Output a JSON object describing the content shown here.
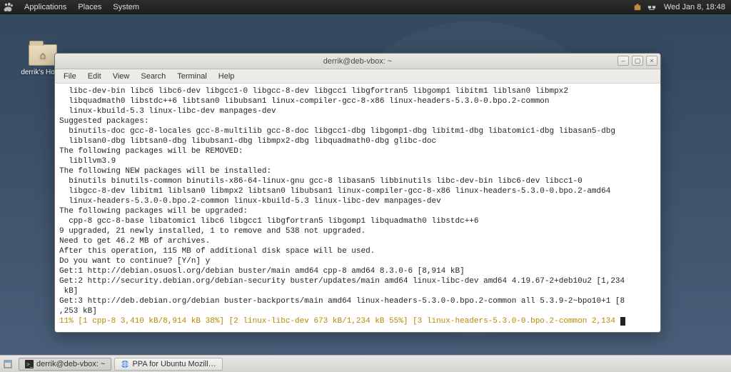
{
  "panel": {
    "menus": [
      "Applications",
      "Places",
      "System"
    ],
    "clock": "Wed Jan  8, 18:48"
  },
  "desktop": {
    "home_label": "derrik's Home"
  },
  "window": {
    "title": "derrik@deb-vbox: ~",
    "menubar": [
      "File",
      "Edit",
      "View",
      "Search",
      "Terminal",
      "Help"
    ],
    "btn_min": "–",
    "btn_max": "▢",
    "btn_close": "×"
  },
  "terminal": {
    "lines": [
      "  libc-dev-bin libc6 libc6-dev libgcc1-0 libgcc-8-dev libgcc1 libgfortran5 libgomp1 libitm1 liblsan0 libmpx2",
      "  libquadmath0 libstdc++6 libtsan0 libubsan1 linux-compiler-gcc-8-x86 linux-headers-5.3.0-0.bpo.2-common",
      "  linux-kbuild-5.3 linux-libc-dev manpages-dev",
      "Suggested packages:",
      "  binutils-doc gcc-8-locales gcc-8-multilib gcc-8-doc libgcc1-dbg libgomp1-dbg libitm1-dbg libatomic1-dbg libasan5-dbg",
      "  liblsan0-dbg libtsan0-dbg libubsan1-dbg libmpx2-dbg libquadmath0-dbg glibc-doc",
      "The following packages will be REMOVED:",
      "  libllvm3.9",
      "The following NEW packages will be installed:",
      "  binutils binutils-common binutils-x86-64-linux-gnu gcc-8 libasan5 libbinutils libc-dev-bin libc6-dev libcc1-0",
      "  libgcc-8-dev libitm1 liblsan0 libmpx2 libtsan0 libubsan1 linux-compiler-gcc-8-x86 linux-headers-5.3.0-0.bpo.2-amd64",
      "  linux-headers-5.3.0-0.bpo.2-common linux-kbuild-5.3 linux-libc-dev manpages-dev",
      "The following packages will be upgraded:",
      "  cpp-8 gcc-8-base libatomic1 libc6 libgcc1 libgfortran5 libgomp1 libquadmath0 libstdc++6",
      "9 upgraded, 21 newly installed, 1 to remove and 538 not upgraded.",
      "Need to get 46.2 MB of archives.",
      "After this operation, 115 MB of additional disk space will be used.",
      "Do you want to continue? [Y/n] y",
      "Get:1 http://debian.osuosl.org/debian buster/main amd64 cpp-8 amd64 8.3.0-6 [8,914 kB]",
      "Get:2 http://security.debian.org/debian-security buster/updates/main amd64 linux-libc-dev amd64 4.19.67-2+deb10u2 [1,234",
      " kB]",
      "Get:3 http://deb.debian.org/debian buster-backports/main amd64 linux-headers-5.3.0-0.bpo.2-common all 5.3.9-2~bpo10+1 [8",
      ",253 kB]"
    ],
    "progress": "11% [1 cpp-8 3,410 kB/8,914 kB 38%] [2 linux-libc-dev 673 kB/1,234 kB 55%] [3 linux-headers-5.3.0-0.bpo.2-common 2,134 "
  },
  "taskbar": {
    "items": [
      {
        "label": "derrik@deb-vbox: ~",
        "active": true,
        "icon": "terminal"
      },
      {
        "label": "PPA for Ubuntu Mozill…",
        "active": false,
        "icon": "web"
      }
    ]
  }
}
